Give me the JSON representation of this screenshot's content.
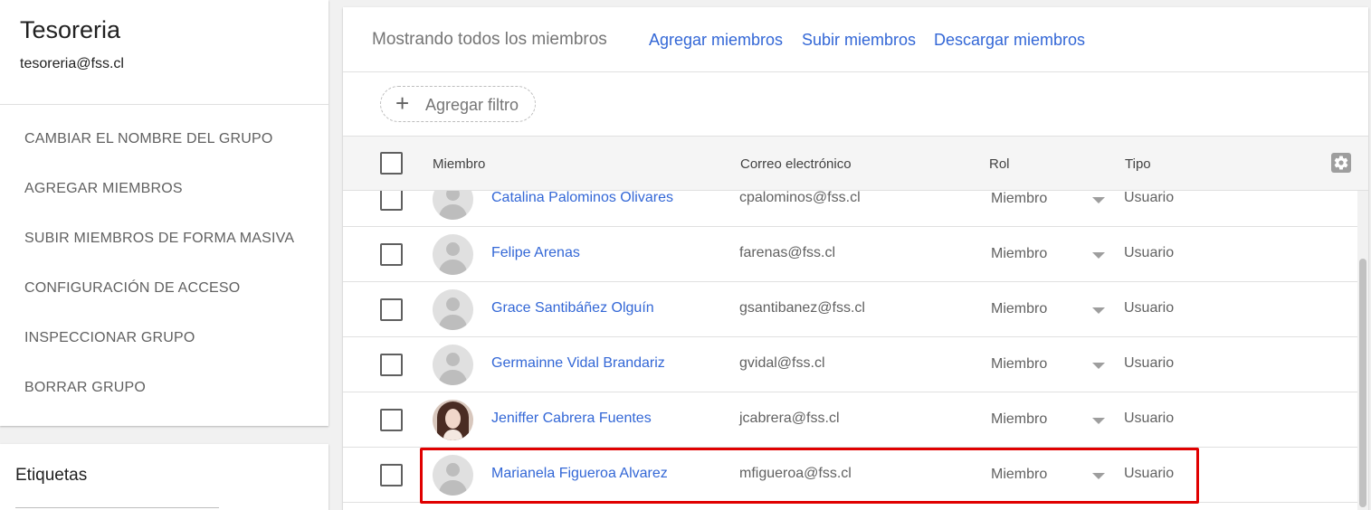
{
  "sidebar": {
    "group_name": "Tesoreria",
    "group_email": "tesoreria@fss.cl",
    "menu": [
      "CAMBIAR EL NOMBRE DEL GRUPO",
      "AGREGAR MIEMBROS",
      "SUBIR MIEMBROS DE FORMA MASIVA",
      "CONFIGURACIÓN DE ACCESO",
      "INSPECCIONAR GRUPO",
      "BORRAR GRUPO"
    ],
    "labels_title": "Etiquetas"
  },
  "toolbar": {
    "showing": "Mostrando todos los miembros",
    "add_members": "Agregar miembros",
    "upload_members": "Subir miembros",
    "download_members": "Descargar miembros"
  },
  "filter": {
    "label": "Agregar filtro"
  },
  "table": {
    "headers": {
      "member": "Miembro",
      "email": "Correo electrónico",
      "role": "Rol",
      "type": "Tipo"
    },
    "rows": [
      {
        "name": "Catalina Palominos Olivares",
        "email": "cpalominos@fss.cl",
        "role": "Miembro",
        "type": "Usuario",
        "avatar": "default-avatar-icon"
      },
      {
        "name": "Felipe Arenas",
        "email": "farenas@fss.cl",
        "role": "Miembro",
        "type": "Usuario",
        "avatar": "default-avatar-icon"
      },
      {
        "name": "Grace Santibáñez Olguín",
        "email": "gsantibanez@fss.cl",
        "role": "Miembro",
        "type": "Usuario",
        "avatar": "default-avatar-icon"
      },
      {
        "name": "Germainne Vidal Brandariz",
        "email": "gvidal@fss.cl",
        "role": "Miembro",
        "type": "Usuario",
        "avatar": "default-avatar-icon"
      },
      {
        "name": "Jeniffer Cabrera Fuentes",
        "email": "jcabrera@fss.cl",
        "role": "Miembro",
        "type": "Usuario",
        "avatar": "profile-photo"
      },
      {
        "name": "Marianela Figueroa Alvarez",
        "email": "mfigueroa@fss.cl",
        "role": "Miembro",
        "type": "Usuario",
        "avatar": "default-avatar-icon"
      }
    ]
  },
  "colors": {
    "link": "#3367d6",
    "highlight": "#e00000"
  }
}
